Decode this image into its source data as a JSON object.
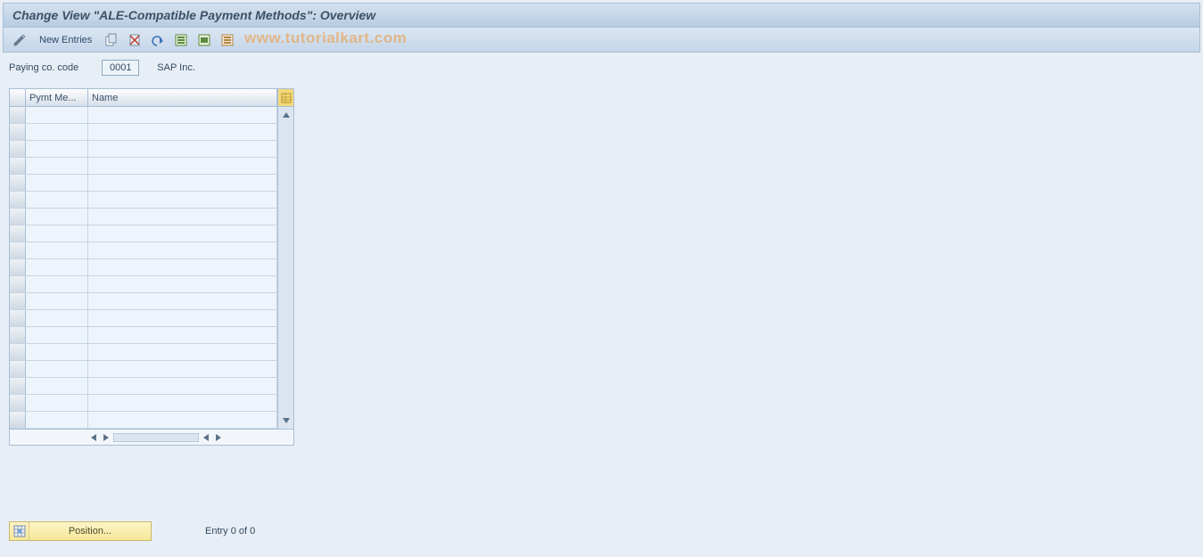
{
  "title": "Change View \"ALE-Compatible Payment Methods\": Overview",
  "toolbar": {
    "new_entries_label": "New Entries"
  },
  "header": {
    "paying_co_label": "Paying co. code",
    "paying_co_value": "0001",
    "company_name": "SAP Inc."
  },
  "grid": {
    "columns": {
      "pymt_method": "Pymt Me...",
      "name": "Name"
    },
    "row_count": 19
  },
  "footer": {
    "position_label": "Position...",
    "entry_text": "Entry 0 of 0"
  },
  "watermark": "www.tutorialkart.com"
}
